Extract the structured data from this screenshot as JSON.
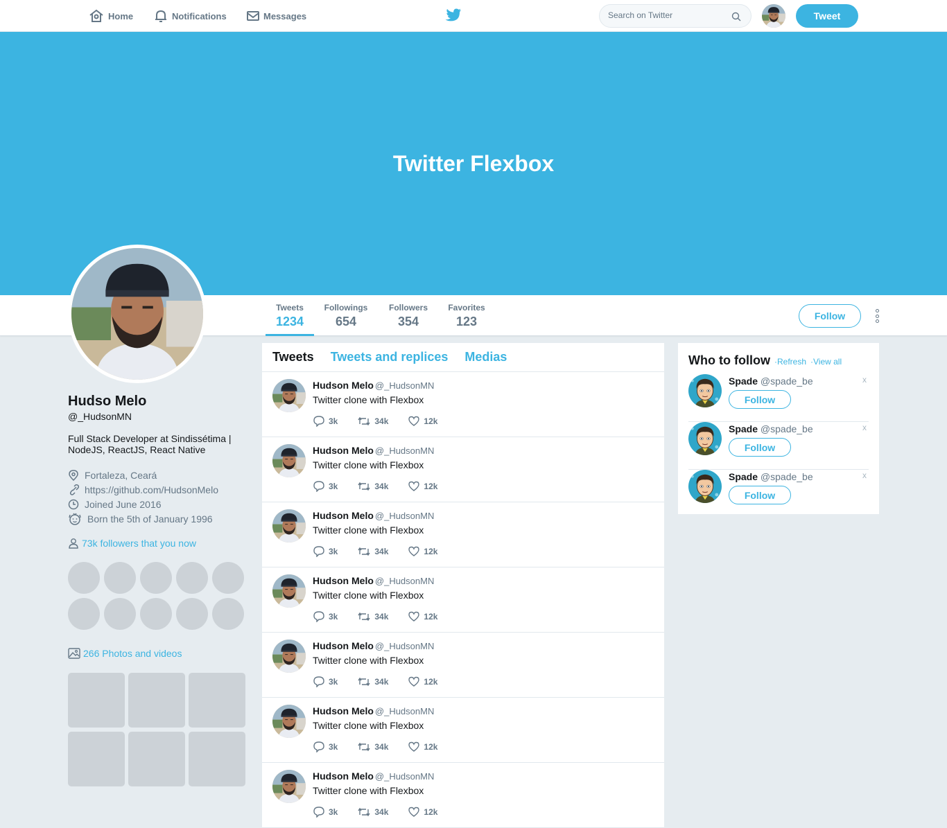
{
  "nav": {
    "home": "Home",
    "notifications": "Notifications",
    "messages": "Messages",
    "search_placeholder": "Search on Twitter",
    "tweet_button": "Tweet"
  },
  "banner": {
    "title": "Twitter Flexbox"
  },
  "stats": [
    {
      "label": "Tweets",
      "value": "1234"
    },
    {
      "label": "Followings",
      "value": "654"
    },
    {
      "label": "Followers",
      "value": "354"
    },
    {
      "label": "Favorites",
      "value": "123"
    }
  ],
  "profile_actions": {
    "follow": "Follow"
  },
  "profile": {
    "name": "Hudso Melo",
    "handle": "@_HudsonMN",
    "bio": "Full Stack Developer at Sindissétima | NodeJS, ReactJS, React Native",
    "location": "Fortaleza, Ceará",
    "website": "https://github.com/HudsonMelo",
    "joined": "Joined June 2016",
    "born": "Born the 5th of January 1996",
    "followers_you_know": "73k followers that you now",
    "photos_videos": "266 Photos and videos"
  },
  "feed": {
    "tabs": [
      "Tweets",
      "Tweets and replices",
      "Medias"
    ],
    "tweets": [
      {
        "name": "Hudson Melo",
        "handle": "@_HudsonMN",
        "text": "Twitter clone with Flexbox",
        "replies": "3k",
        "retweets": "34k",
        "likes": "12k"
      },
      {
        "name": "Hudson Melo",
        "handle": "@_HudsonMN",
        "text": "Twitter clone with Flexbox",
        "replies": "3k",
        "retweets": "34k",
        "likes": "12k"
      },
      {
        "name": "Hudson Melo",
        "handle": "@_HudsonMN",
        "text": "Twitter clone with Flexbox",
        "replies": "3k",
        "retweets": "34k",
        "likes": "12k"
      },
      {
        "name": "Hudson Melo",
        "handle": "@_HudsonMN",
        "text": "Twitter clone with Flexbox",
        "replies": "3k",
        "retweets": "34k",
        "likes": "12k"
      },
      {
        "name": "Hudson Melo",
        "handle": "@_HudsonMN",
        "text": "Twitter clone with Flexbox",
        "replies": "3k",
        "retweets": "34k",
        "likes": "12k"
      },
      {
        "name": "Hudson Melo",
        "handle": "@_HudsonMN",
        "text": "Twitter clone with Flexbox",
        "replies": "3k",
        "retweets": "34k",
        "likes": "12k"
      },
      {
        "name": "Hudson Melo",
        "handle": "@_HudsonMN",
        "text": "Twitter clone with Flexbox",
        "replies": "3k",
        "retweets": "34k",
        "likes": "12k"
      }
    ]
  },
  "who_to_follow": {
    "title": "Who to follow",
    "refresh": "·Refresh",
    "view_all": "·View all",
    "items": [
      {
        "name": "Spade",
        "handle": "@spade_be",
        "follow": "Follow",
        "close": "x"
      },
      {
        "name": "Spade",
        "handle": "@spade_be",
        "follow": "Follow",
        "close": "x"
      },
      {
        "name": "Spade",
        "handle": "@spade_be",
        "follow": "Follow",
        "close": "x"
      }
    ]
  },
  "colors": {
    "accent": "#3cb4e1",
    "background": "#e6ecf0",
    "muted": "#657786"
  }
}
